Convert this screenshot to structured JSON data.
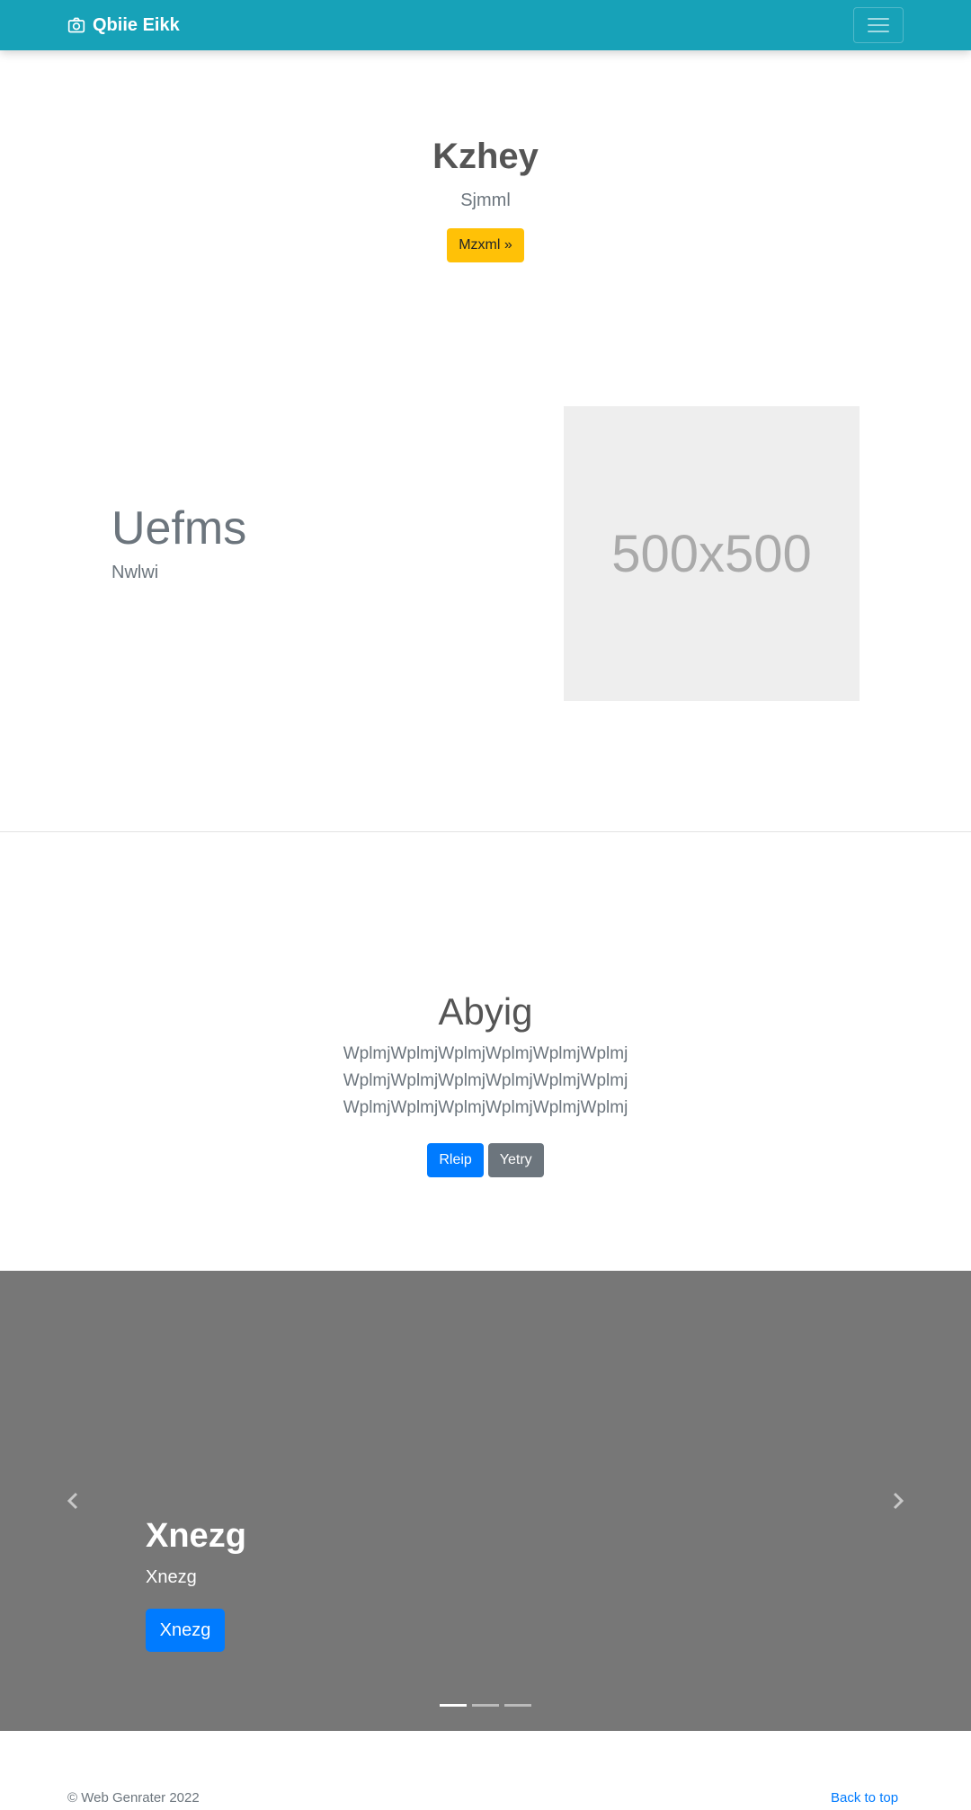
{
  "navbar": {
    "brand": "Qbiie Eikk",
    "brand_icon": "camera-icon",
    "toggler_icon": "hamburger-menu-icon",
    "background": "#17a2b8"
  },
  "hero": {
    "title": "Kzhey",
    "subtitle": "Sjmml",
    "button": "Mzxml »",
    "button_color": "#ffc107"
  },
  "feature": {
    "heading": "Uefms",
    "subheading": "Nwlwi",
    "image_label": "500x500"
  },
  "about": {
    "title": "Abyig",
    "lines": [
      "WplmjWplmjWplmjWplmjWplmjWplmj",
      "WplmjWplmjWplmjWplmjWplmjWplmj",
      "WplmjWplmjWplmjWplmjWplmjWplmj"
    ],
    "primary_button": "Rleip",
    "secondary_button": "Yetry",
    "primary_color": "#007bff",
    "secondary_color": "#6c757d"
  },
  "carousel": {
    "title": "Xnezg",
    "subtitle": "Xnezg",
    "button": "Xnezg",
    "prev_icon": "chevron-left-icon",
    "next_icon": "chevron-right-icon",
    "slide_count": 3,
    "active_slide": 1,
    "background": "#777777"
  },
  "footer": {
    "copyright": "© Web Genrater 2022",
    "back_to_top": "Back to top"
  }
}
